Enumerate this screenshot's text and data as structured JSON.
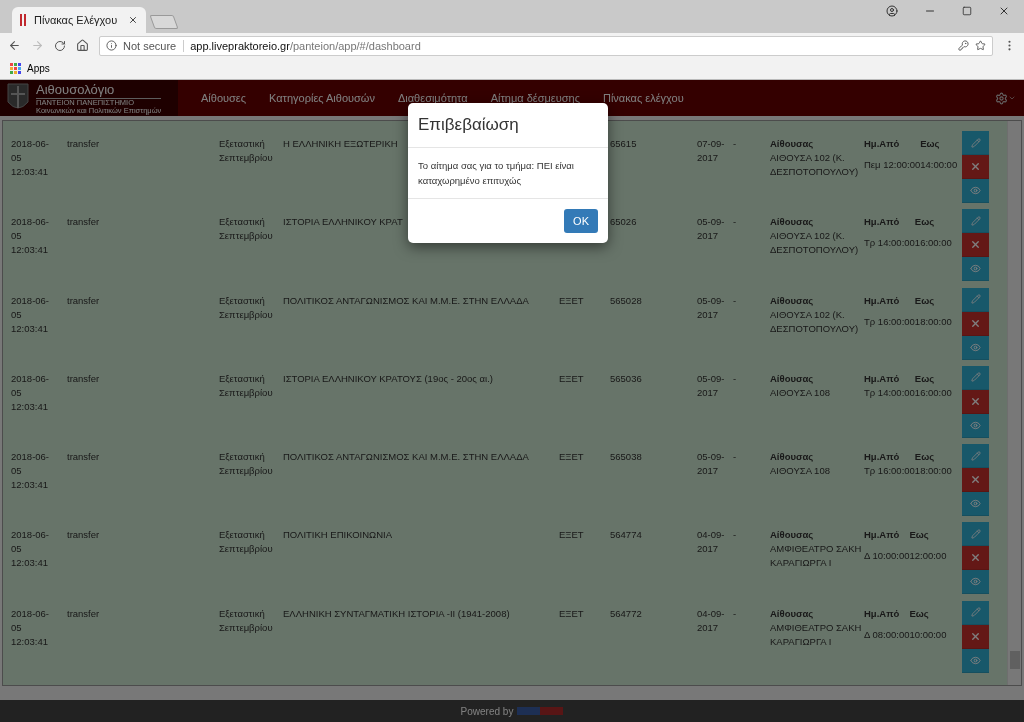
{
  "browser": {
    "tab_title": "Πίνακας Ελέγχου",
    "security": "Not secure",
    "host": "app.livepraktoreio.gr",
    "path": "/panteion/app/#/dashboard",
    "bookmarks": [
      "Apps"
    ]
  },
  "navbar": {
    "brand": {
      "title": "Αιθουσολόγιο",
      "line1": "ΠΑΝΤΕΙΟΝ ΠΑΝΕΠΙΣΤΗΜΙΟ",
      "line2": "Κοινωνικών και Πολιτικών Επιστημών"
    },
    "items": [
      "Αίθουσες",
      "Κατηγορίες Αιθουσών",
      "Διαθεσιμότητα",
      "Αίτημα δέσμευσης",
      "Πίνακας ελέγχου"
    ]
  },
  "rows": [
    {
      "submitted": "2018-06-05 12:03:41",
      "type": "transfer",
      "period": "Εξεταστική Σεπτεμβρίου",
      "course": "Η ΕΛΛΗΝΙΚΗ ΕΞΩΤΕΡΙΚΗ",
      "code": "65615",
      "date": "07-09-2017",
      "date_to": "-",
      "room": {
        "headers": [
          "Αίθουσας",
          "Ημ.Από",
          "Εως"
        ],
        "name": "ΑΙΘΟΥΣΑ 102 (Κ. ΔΕΣΠΟΤΟΠΟΥΛΟΥ)",
        "day": "Πεμ",
        "from": "12:00:00",
        "to": "14:00:00"
      }
    },
    {
      "submitted": "2018-06-05 12:03:41",
      "type": "transfer",
      "period": "Εξεταστική Σεπτεμβρίου",
      "course": "ΙΣΤΟΡΙΑ ΕΛΛΗΝΙΚΟΥ ΚΡΑΤ",
      "code": "65026",
      "date": "05-09-2017",
      "date_to": "-",
      "room": {
        "headers": [
          "Αίθουσας",
          "Ημ.Από",
          "Εως"
        ],
        "name": "ΑΙΘΟΥΣΑ 102 (Κ. ΔΕΣΠΟΤΟΠΟΥΛΟΥ)",
        "day": "Τρ",
        "from": "14:00:00",
        "to": "16:00:00"
      }
    },
    {
      "submitted": "2018-06-05 12:03:41",
      "type": "transfer",
      "period": "Εξεταστική Σεπτεμβρίου",
      "course": "ΠΟΛΙΤΙΚΟΣ ΑΝΤΑΓΩΝΙΣΜΟΣ ΚΑΙ Μ.Μ.Ε. ΣΤΗΝ ΕΛΛΑΔΑ",
      "dept": "ΕΞΕΤ",
      "code": "565028",
      "date": "05-09-2017",
      "date_to": "-",
      "room": {
        "headers": [
          "Αίθουσας",
          "Ημ.Από",
          "Εως"
        ],
        "name": "ΑΙΘΟΥΣΑ 102 (Κ. ΔΕΣΠΟΤΟΠΟΥΛΟΥ)",
        "day": "Τρ",
        "from": "16:00:00",
        "to": "18:00:00"
      }
    },
    {
      "submitted": "2018-06-05 12:03:41",
      "type": "transfer",
      "period": "Εξεταστική Σεπτεμβρίου",
      "course": "ΙΣΤΟΡΙΑ ΕΛΛΗΝΙΚΟΥ ΚΡΑΤΟΥΣ (19ος - 20ος αι.)",
      "dept": "ΕΞΕΤ",
      "code": "565036",
      "date": "05-09-2017",
      "date_to": "-",
      "room": {
        "headers": [
          "Αίθουσας",
          "Ημ.Από",
          "Εως"
        ],
        "name": "ΑΙΘΟΥΣΑ 108",
        "day": "Τρ",
        "from": "14:00:00",
        "to": "16:00:00"
      }
    },
    {
      "submitted": "2018-06-05 12:03:41",
      "type": "transfer",
      "period": "Εξεταστική Σεπτεμβρίου",
      "course": "ΠΟΛΙΤΙΚΟΣ ΑΝΤΑΓΩΝΙΣΜΟΣ ΚΑΙ Μ.Μ.Ε. ΣΤΗΝ ΕΛΛΑΔΑ",
      "dept": "ΕΞΕΤ",
      "code": "565038",
      "date": "05-09-2017",
      "date_to": "-",
      "room": {
        "headers": [
          "Αίθουσας",
          "Ημ.Από",
          "Εως"
        ],
        "name": "ΑΙΘΟΥΣΑ 108",
        "day": "Τρ",
        "from": "16:00:00",
        "to": "18:00:00"
      }
    },
    {
      "submitted": "2018-06-05 12:03:41",
      "type": "transfer",
      "period": "Εξεταστική Σεπτεμβρίου",
      "course": "ΠΟΛΙΤΙΚΗ ΕΠΙΚΟΙΝΩΝΙΑ",
      "dept": "ΕΞΕΤ",
      "code": "564774",
      "date": "04-09-2017",
      "date_to": "-",
      "room": {
        "headers": [
          "Αίθουσας",
          "Ημ.Από",
          "Εως"
        ],
        "name": "ΑΜΦΙΘΕΑΤΡΟ ΣΑΚΗ ΚΑΡΑΓΙΩΡΓΑ Ι",
        "day": "Δ",
        "from": "10:00:00",
        "to": "12:00:00"
      }
    },
    {
      "submitted": "2018-06-05 12:03:41",
      "type": "transfer",
      "period": "Εξεταστική Σεπτεμβρίου",
      "course": "ΕΛΛΗΝΙΚΗ ΣΥΝΤΑΓΜΑΤΙΚΗ ΙΣΤΟΡΙΑ -ΙΙ (1941-2008)",
      "dept": "ΕΞΕΤ",
      "code": "564772",
      "date": "04-09-2017",
      "date_to": "-",
      "room": {
        "headers": [
          "Αίθουσας",
          "Ημ.Από",
          "Εως"
        ],
        "name": "ΑΜΦΙΘΕΑΤΡΟ ΣΑΚΗ ΚΑΡΑΓΙΩΡΓΑ Ι",
        "day": "Δ",
        "from": "08:00:00",
        "to": "10:00:00"
      }
    }
  ],
  "modal": {
    "title": "Επιβεβαίωση",
    "message": "Το αίτημα σας για το τμήμα: ΠΕΙ είναι καταχωρημένο επιτυχώς",
    "button": "OK"
  },
  "footer": {
    "text": "Powered by"
  }
}
